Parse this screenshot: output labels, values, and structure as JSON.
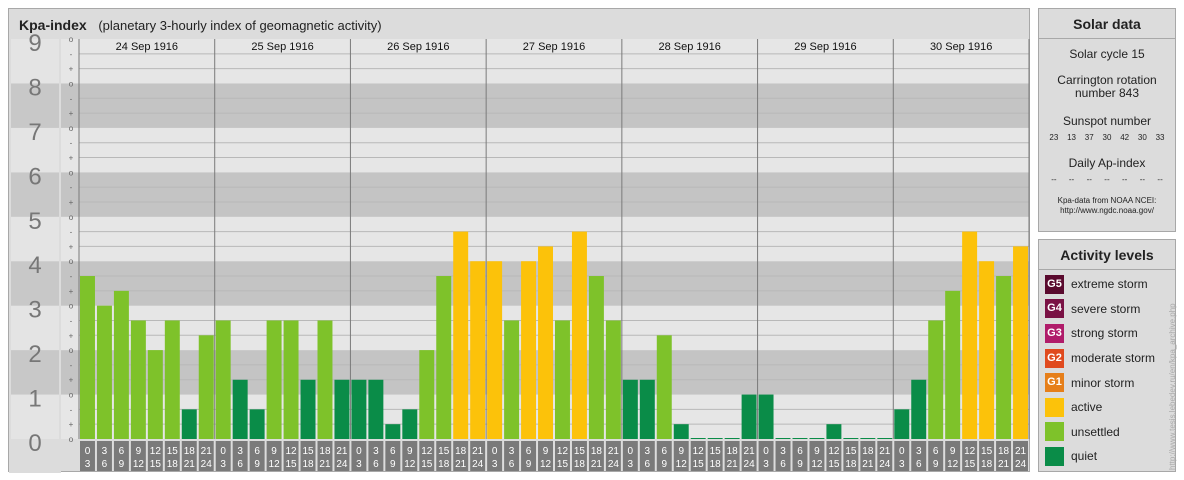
{
  "header": {
    "title": "Kpa-index",
    "subtitle": "(planetary 3-hourly index of geomagnetic activity)"
  },
  "chart_data": {
    "type": "bar",
    "title": "Kpa-index",
    "subtitle": "(planetary 3-hourly index of geomagnetic activity)",
    "ylim": [
      0,
      9
    ],
    "y_ticks": [
      "0",
      "1",
      "2",
      "3",
      "4",
      "5",
      "6",
      "7",
      "8",
      "9"
    ],
    "sub_ticks": [
      "o",
      "+",
      "-"
    ],
    "days": [
      "24 Sep 1916",
      "25 Sep 1916",
      "26 Sep 1916",
      "27 Sep 1916",
      "28 Sep 1916",
      "29 Sep 1916",
      "30 Sep 1916"
    ],
    "interval_starts": [
      "0",
      "3",
      "6",
      "9",
      "12",
      "15",
      "18",
      "21"
    ],
    "interval_ends": [
      "3",
      "6",
      "9",
      "12",
      "15",
      "18",
      "21",
      "24"
    ],
    "values": [
      3.667,
      3.0,
      3.333,
      2.667,
      2.0,
      2.667,
      0.667,
      2.333,
      2.667,
      1.333,
      0.667,
      2.667,
      2.667,
      1.333,
      2.667,
      1.333,
      1.333,
      1.333,
      0.333,
      0.667,
      2.0,
      3.667,
      4.667,
      4.0,
      4.0,
      2.667,
      4.0,
      4.333,
      2.667,
      4.667,
      3.667,
      2.667,
      1.333,
      1.333,
      2.333,
      0.333,
      0.0,
      0.0,
      0.0,
      1.0,
      1.0,
      0.0,
      0.0,
      0.0,
      0.333,
      0.0,
      0.0,
      0.0,
      0.667,
      1.333,
      2.667,
      3.333,
      4.667,
      4.0,
      3.667,
      4.333
    ],
    "grid": true,
    "legend_placement": "right panel"
  },
  "solar": {
    "title": "Solar data",
    "cycle": "Solar cycle 15",
    "carrington_line1": "Carrington rotation",
    "carrington_line2": "number 843",
    "sunspot_label": "Sunspot number",
    "sunspot_values": [
      "23",
      "13",
      "37",
      "30",
      "42",
      "30",
      "33"
    ],
    "ap_label": "Daily Ap-index",
    "ap_values": [
      "--",
      "--",
      "--",
      "--",
      "--",
      "--",
      "--"
    ],
    "source_line1": "Kpa-data from NOAA NCEI:",
    "source_line2": "http://www.ngdc.noaa.gov/"
  },
  "legend": {
    "title": "Activity levels",
    "items": [
      {
        "badge": "G5",
        "label": "extreme storm",
        "color": "#5a0a2e"
      },
      {
        "badge": "G4",
        "label": "severe storm",
        "color": "#7a1245"
      },
      {
        "badge": "G3",
        "label": "strong storm",
        "color": "#b01c6a"
      },
      {
        "badge": "G2",
        "label": "moderate storm",
        "color": "#e04a1e"
      },
      {
        "badge": "G1",
        "label": "minor storm",
        "color": "#e67f1a"
      },
      {
        "badge": "",
        "label": "active",
        "color": "#fcc20a"
      },
      {
        "badge": "",
        "label": "unsettled",
        "color": "#7ec22a"
      },
      {
        "badge": "",
        "label": "quiet",
        "color": "#0a8c48"
      }
    ]
  },
  "credit": "http://www.tesis.lebedev.ru/en/kpa_archive.php"
}
